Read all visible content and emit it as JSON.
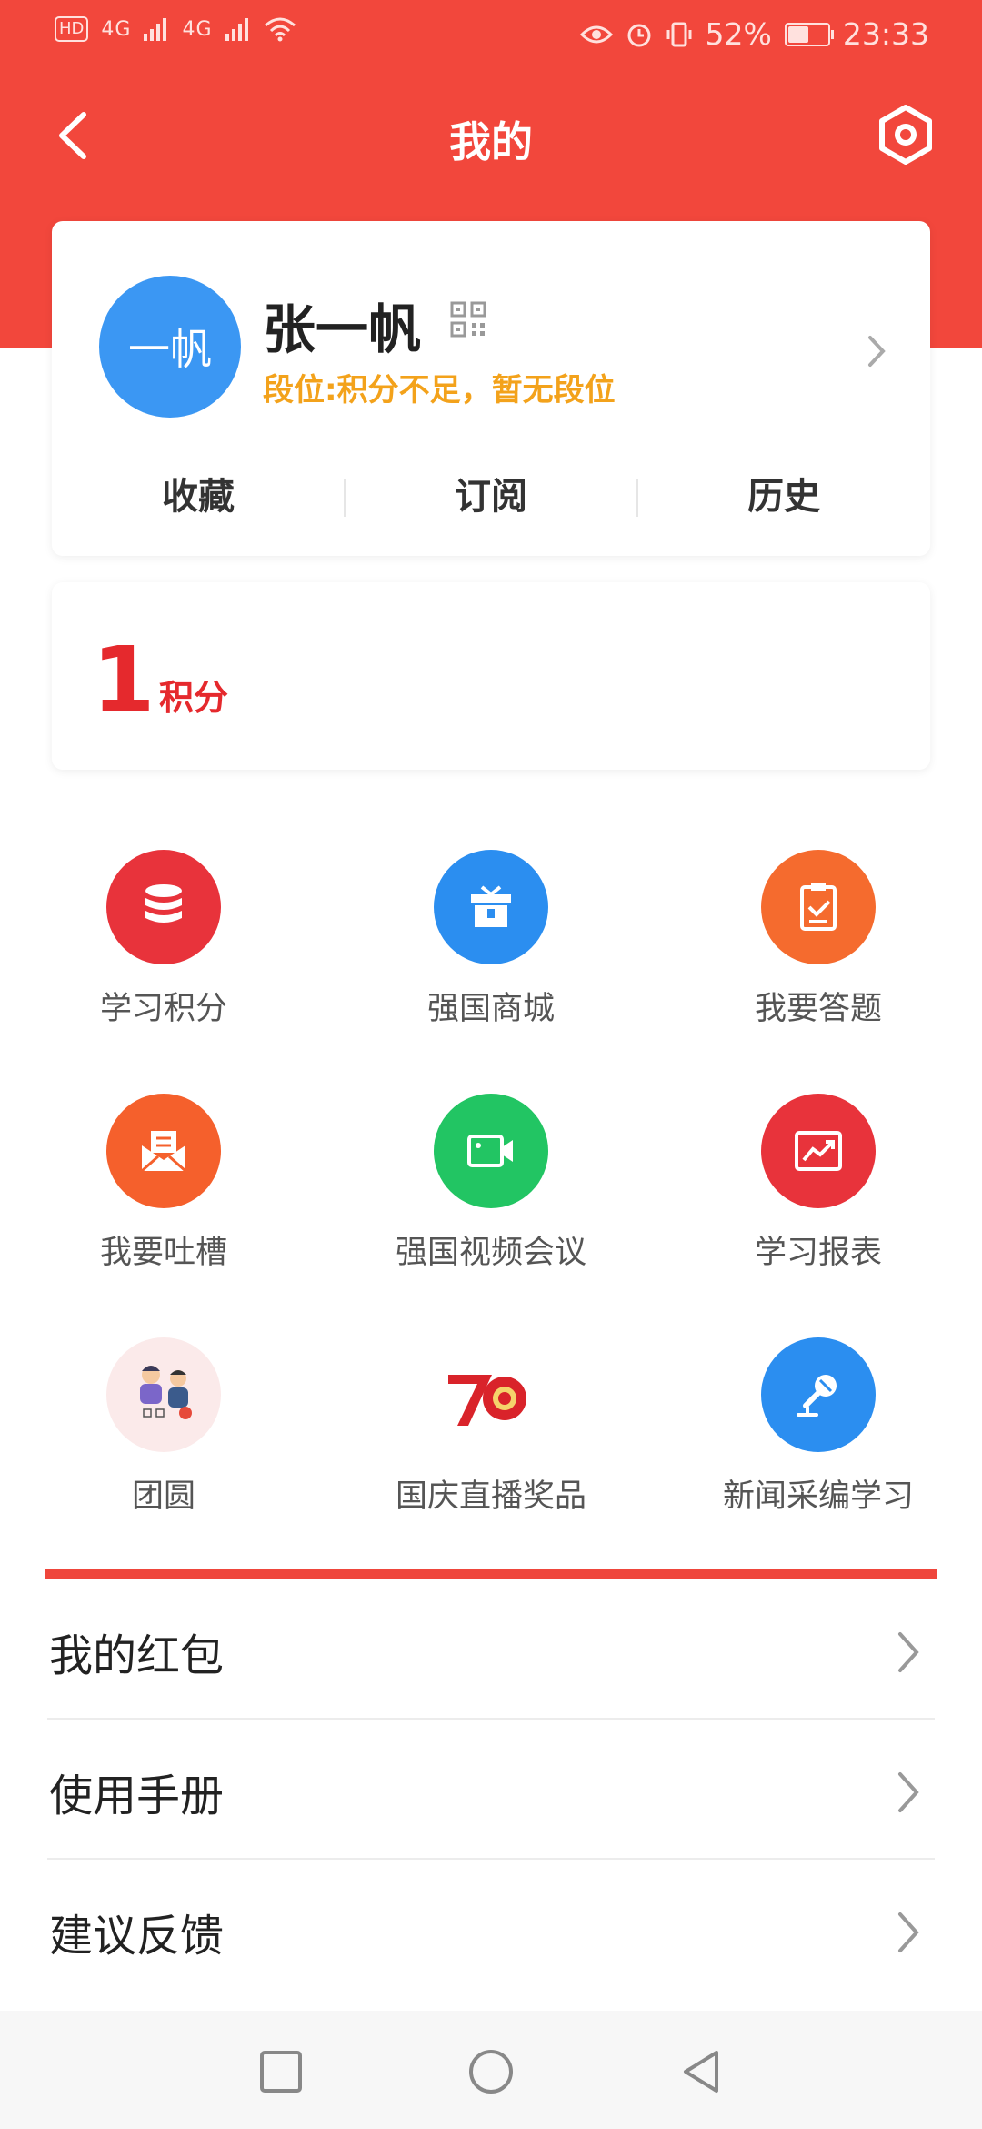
{
  "status_bar": {
    "hd": "HD",
    "net1": "4G",
    "net2": "4G",
    "battery_pct": "52%",
    "battery_level": 0.52,
    "time": "23:33"
  },
  "header": {
    "title": "我的",
    "bg_color": "#f2473c"
  },
  "profile": {
    "avatar_text": "一帆",
    "name": "张一帆",
    "rank": "段位:积分不足，暂无段位",
    "shortcuts": [
      "收藏",
      "订阅",
      "历史"
    ]
  },
  "points": {
    "value": "1",
    "label": "积分"
  },
  "grid": [
    {
      "label": "学习积分",
      "icon": "database-icon",
      "color": "#e8333b"
    },
    {
      "label": "强国商城",
      "icon": "gift-icon",
      "color": "#2b8ef0"
    },
    {
      "label": "我要答题",
      "icon": "clipboard-check-icon",
      "color": "#f56b2e"
    },
    {
      "label": "我要吐槽",
      "icon": "mail-open-icon",
      "color": "#f5602c"
    },
    {
      "label": "强国视频会议",
      "icon": "video-camera-icon",
      "color": "#22c563"
    },
    {
      "label": "学习报表",
      "icon": "chart-report-icon",
      "color": "#e8333b"
    },
    {
      "label": "团圆",
      "icon": "reunion-illustration-icon",
      "color": "#fbeaea"
    },
    {
      "label": "国庆直播奖品",
      "icon": "seventy-anniversary-logo-icon",
      "color": "#ffffff"
    },
    {
      "label": "新闻采编学习",
      "icon": "microphone-icon",
      "color": "#2b8ef0"
    }
  ],
  "list": [
    {
      "label": "我的红包"
    },
    {
      "label": "使用手册"
    },
    {
      "label": "建议反馈"
    }
  ]
}
